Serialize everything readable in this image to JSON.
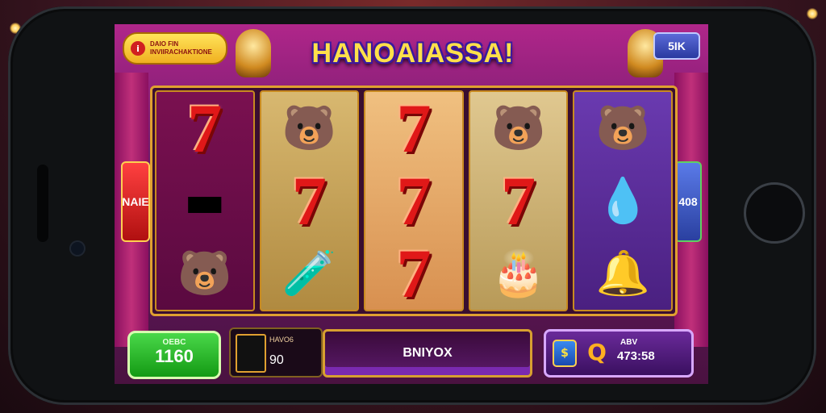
{
  "game": {
    "title": "HANOAIASSA!",
    "info_lines": [
      "DAIO FIN",
      "INVIIRACHAKTIONE"
    ],
    "top_right_badge": "5IK",
    "side_left_label": "NAIE",
    "side_right_label": "408"
  },
  "reels": [
    [
      "red-seven",
      "gold-bar",
      "blue-cap-bear"
    ],
    [
      "bear-with-hat",
      "red-seven",
      "purple-potion"
    ],
    [
      "red-seven",
      "red-seven",
      "red-seven"
    ],
    [
      "green-cap-bear",
      "red-seven",
      "cake-crate"
    ],
    [
      "brown-bear",
      "blue-gem",
      "gold-bell"
    ]
  ],
  "symbol_glyphs": {
    "red-seven": "7",
    "gold-bar": "▬",
    "blue-cap-bear": "🐻",
    "bear-with-hat": "🐻",
    "purple-potion": "🧪",
    "green-cap-bear": "🐻",
    "cake-crate": "🎂",
    "brown-bear": "🐻",
    "blue-gem": "💧",
    "gold-bell": "🔔"
  },
  "controls": {
    "credit_label": "OEBC",
    "credit_value": "1160",
    "bet_label": "HAVO6",
    "bet_value": "90",
    "spin_label": "BNIYOX",
    "win_label": "ABV",
    "win_value": "473:58",
    "win_icon_left": "$",
    "win_icon_right": "Q"
  },
  "colors": {
    "accent_gold": "#e0a030",
    "seven_red": "#e01818",
    "credit_green": "#1eaa1e",
    "spin_purple": "#7a2ab0"
  }
}
